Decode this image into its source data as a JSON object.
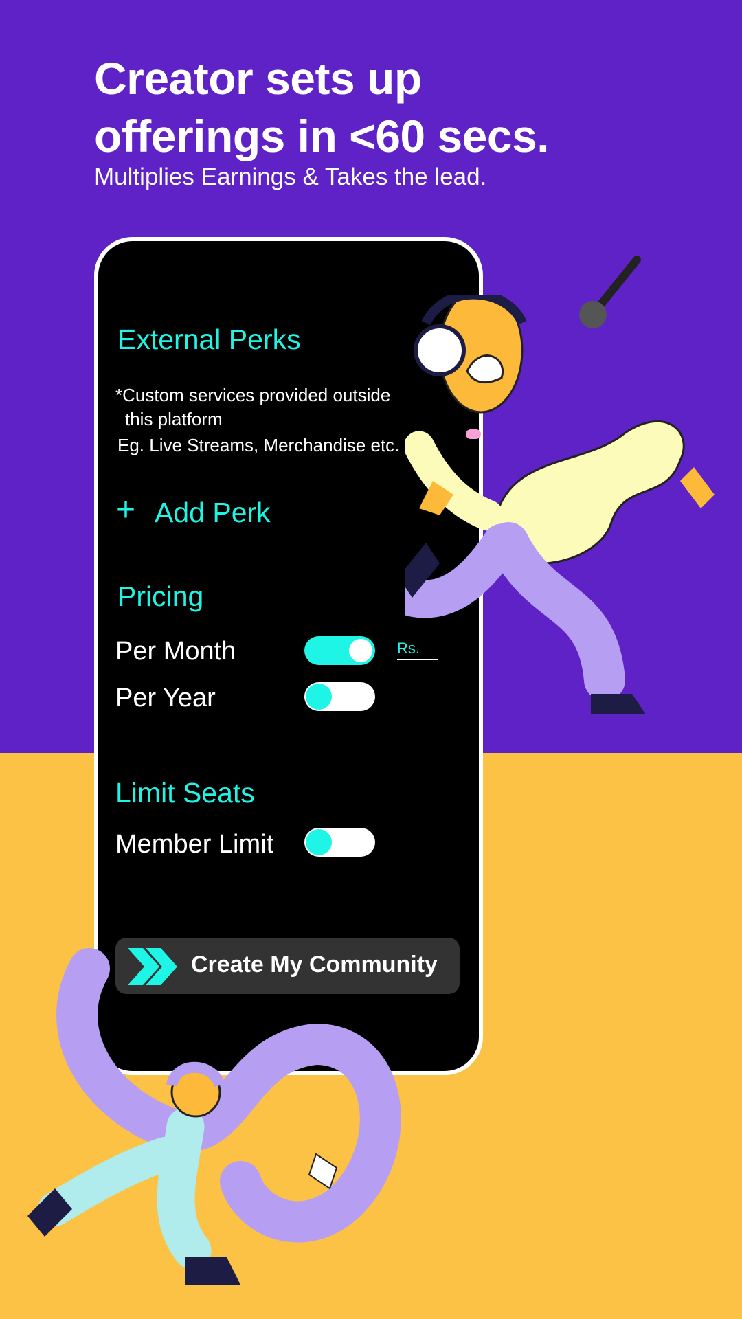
{
  "hero": {
    "title_line1": "Creator sets up",
    "title_line2": "offerings in <60 secs.",
    "subtitle": "Multiplies Earnings & Takes the lead."
  },
  "phone": {
    "external_perks": {
      "heading": "External Perks",
      "desc_line1": "*Custom services provided outside",
      "desc_line2": "this platform",
      "desc_line3": "Eg.  Live Streams, Merchandise etc.",
      "add_perk_icon": "plus-icon",
      "add_perk_label": "Add Perk"
    },
    "pricing": {
      "heading": "Pricing",
      "per_month_label": "Per Month",
      "per_month_on": true,
      "per_year_label": "Per Year",
      "per_year_on": false,
      "currency_label": "Rs.",
      "price_value": ""
    },
    "limit_seats": {
      "heading": "Limit Seats",
      "member_limit_label": "Member Limit",
      "member_limit_on": false
    },
    "create_button": {
      "icon": "double-chevron-right-icon",
      "label": "Create My Community"
    }
  },
  "colors": {
    "purple": "#5f22c6",
    "yellow": "#fcc245",
    "accent": "#1ff5e6",
    "button": "#333333"
  }
}
